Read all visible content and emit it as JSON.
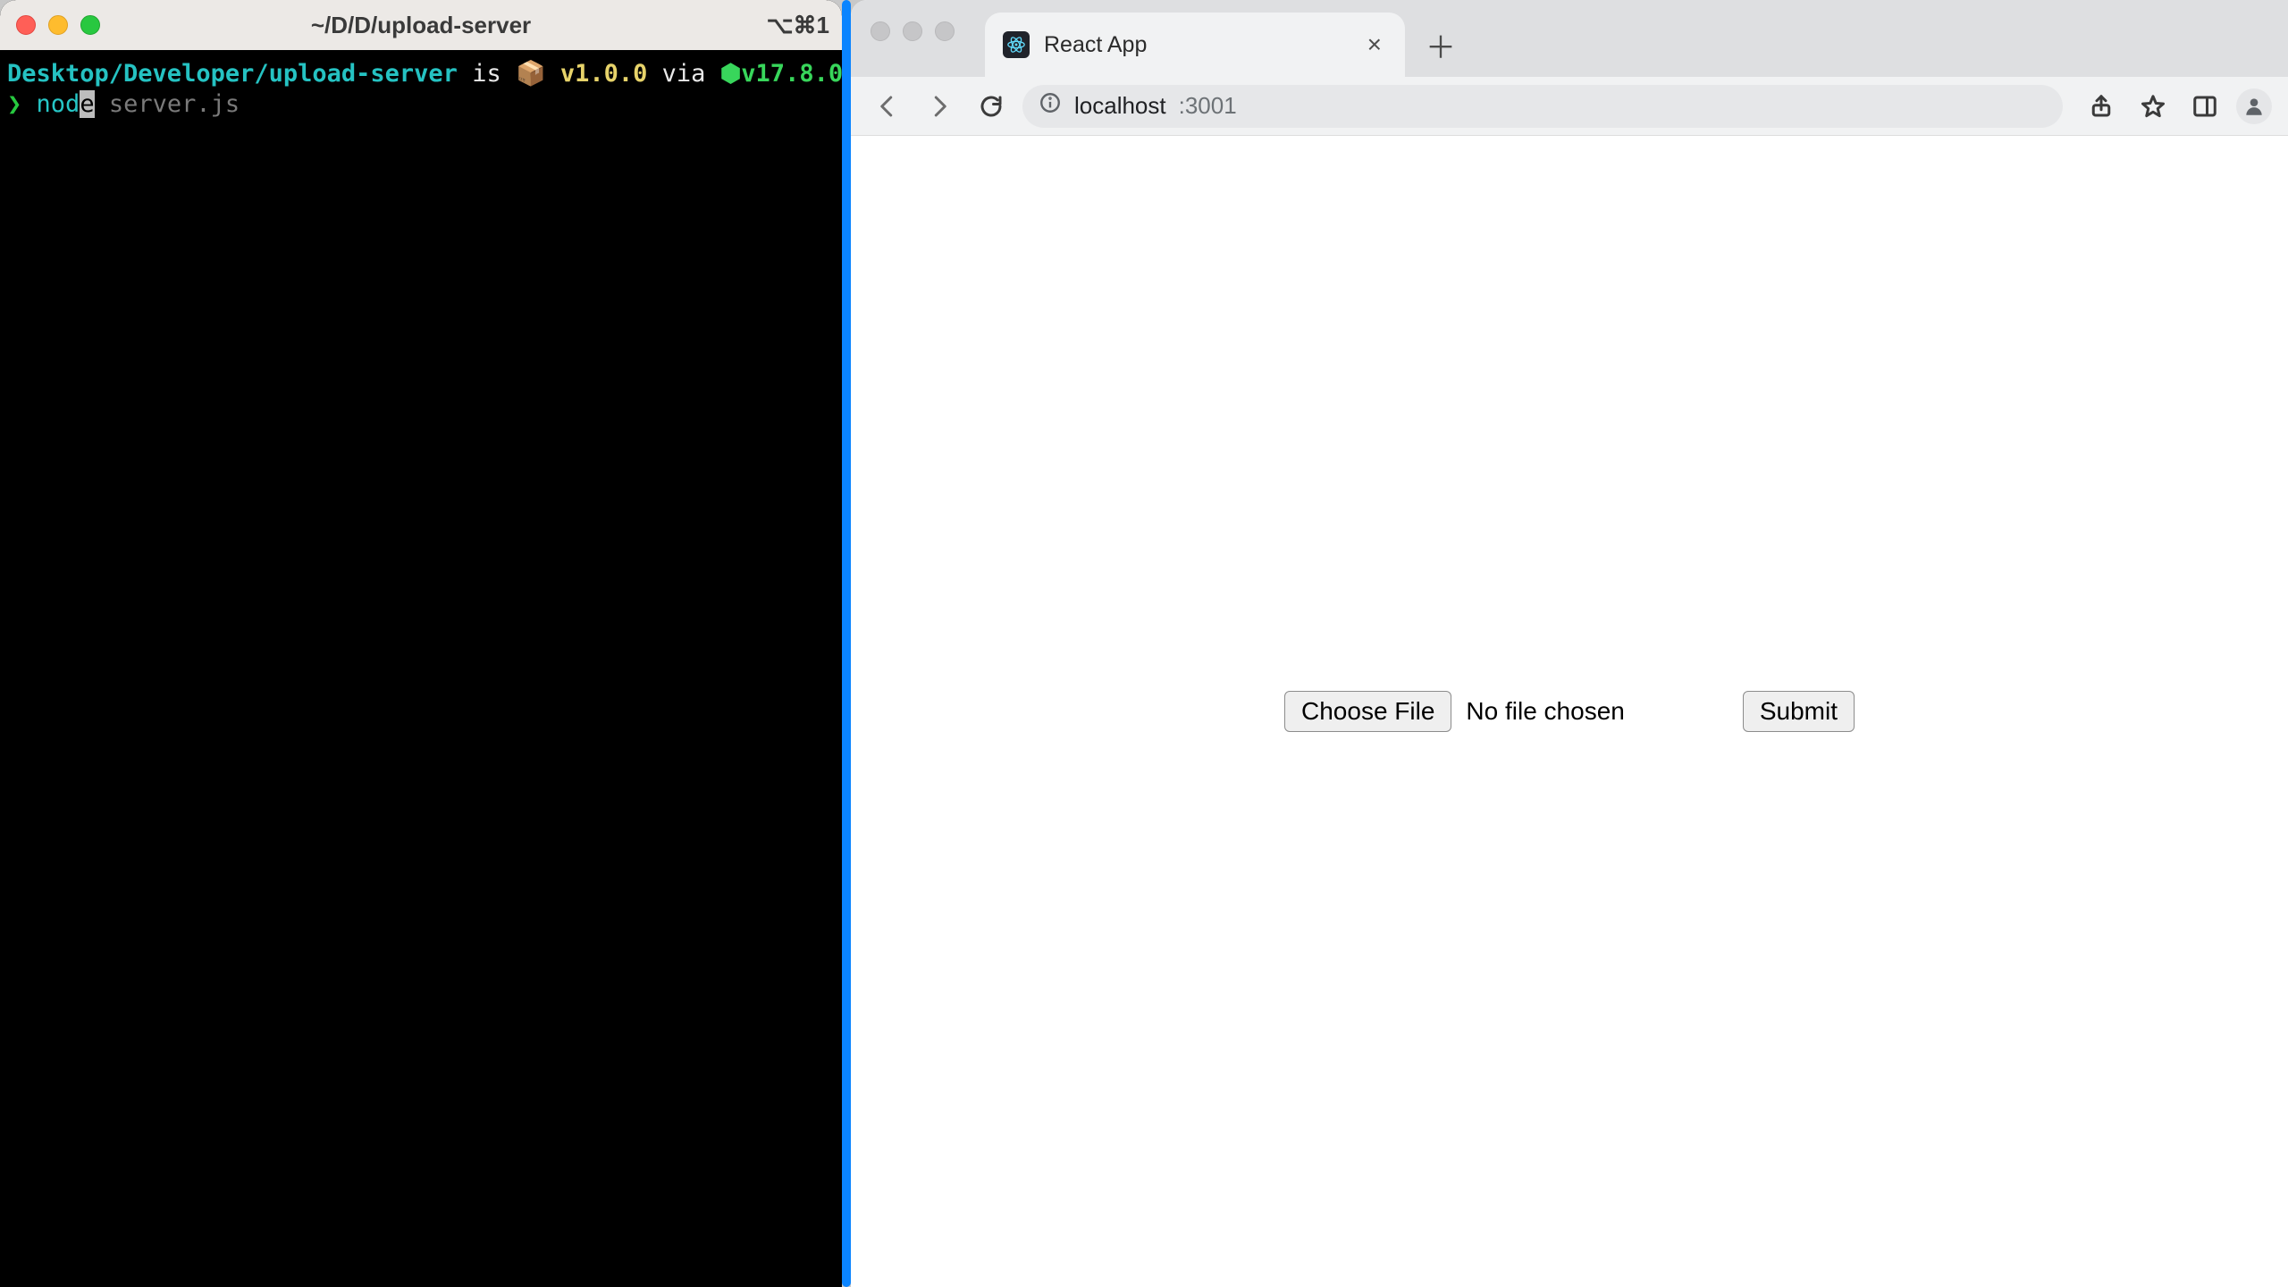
{
  "terminal": {
    "title": "~/D/D/upload-server",
    "right_indicator": "⌥⌘1",
    "prompt": {
      "path": "Desktop/Developer/upload-server",
      "is": "is",
      "pkg_emoji": "📦",
      "version": "v1.0.0",
      "via": "via",
      "node_icon": "⬢",
      "node_version": "v17.8.0",
      "symbol": "❯",
      "typed_prefix": "nod",
      "typed_cursor": "e",
      "suggestion_rest": " server.js"
    }
  },
  "browser": {
    "tab_title": "React App",
    "address_host": "localhost",
    "address_path": ":3001",
    "page": {
      "choose_file_label": "Choose File",
      "file_status": "No file chosen",
      "submit_label": "Submit"
    }
  }
}
